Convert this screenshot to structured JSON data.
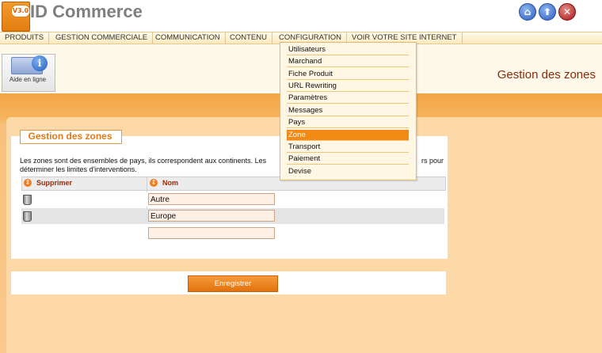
{
  "app": {
    "logo_badge": "V3.0",
    "logo_text": "ID Commerce"
  },
  "header_buttons": [
    {
      "name": "home",
      "symbol": "⌂"
    },
    {
      "name": "up",
      "symbol": "⬆"
    },
    {
      "name": "close",
      "symbol": "✕"
    }
  ],
  "menu": {
    "items": [
      "PRODUITS",
      "GESTION COMMERCIALE",
      "COMMUNICATION",
      "CONTENU",
      "CONFIGURATION",
      "VOIR VOTRE SITE INTERNET"
    ]
  },
  "dropdown": {
    "items": [
      "Utilisateurs",
      "Marchand",
      "Fiche Produit",
      "URL Rewriting",
      "Paramètres",
      "Messages",
      "Pays",
      "Zone",
      "Transport",
      "Paiement",
      "Devise"
    ],
    "active": "Zone"
  },
  "help": {
    "label": "Aide en ligne",
    "icon": "i"
  },
  "page": {
    "title": "Gestion des zones"
  },
  "panel": {
    "title": "Gestion des zones",
    "intro_line1": "Les zones sont des ensembles de pays, ils correspondent aux continents. Les",
    "intro_line1_tail": "rs pour",
    "intro_line2": "déterminer les limites d'interventions."
  },
  "table": {
    "columns": [
      "Supprimer",
      "Nom"
    ],
    "sort_icon": "⇕",
    "rows": [
      {
        "nom": "Autre"
      },
      {
        "nom": "Europe"
      }
    ],
    "new_value": ""
  },
  "save": {
    "label": "Enregistrer"
  }
}
